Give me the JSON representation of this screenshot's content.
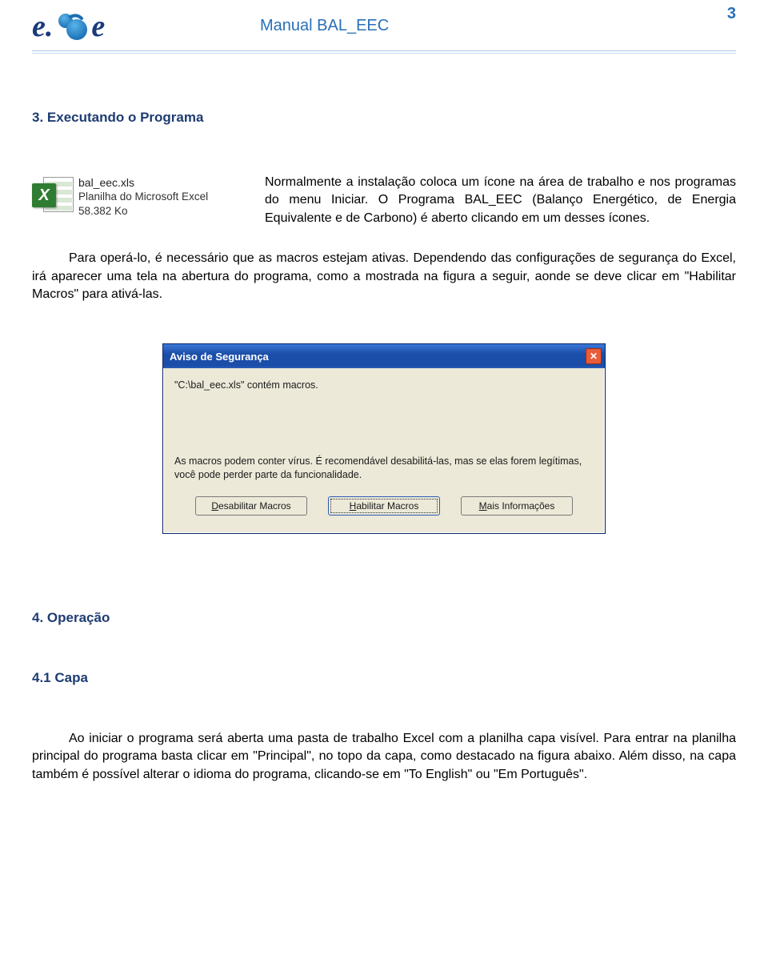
{
  "header": {
    "title": "Manual BAL_EEC",
    "page_number": "3",
    "logo": {
      "left": "e.",
      "right": "e",
      "amp_icon": "ampersand-logo-icon"
    }
  },
  "section3": {
    "heading": "3. Executando o Programa",
    "file_card": {
      "filename": "bal_eec.xls",
      "type": "Planilha do Microsoft Excel",
      "size": "58.382 Ko",
      "icon": "excel-file-icon"
    },
    "intro": "Normalmente a instalação coloca um ícone na área de trabalho e nos programas do menu Iniciar. O Programa BAL_EEC (Balanço Energético, de Energia Equivalente e de Carbono) é aberto clicando em um desses ícones.",
    "para": "Para operá-lo, é necessário que as macros estejam ativas. Dependendo das configurações de segurança do Excel, irá aparecer uma tela na abertura do programa, como a mostrada na figura a seguir, aonde se deve clicar em \"Habilitar Macros\" para ativá-las."
  },
  "dialog": {
    "title": "Aviso de Segurança",
    "close_icon": "close-icon",
    "line1": "\"C:\\bal_eec.xls\" contém macros.",
    "message": "As macros podem conter vírus. É recomendável desabilitá-las, mas se elas forem legítimas, você pode perder parte da funcionalidade.",
    "buttons": {
      "disable": {
        "label": "Desabilitar Macros",
        "underline_index": 0
      },
      "enable": {
        "label": "Habilitar Macros",
        "underline_index": 0
      },
      "more": {
        "label": "Mais Informações",
        "underline_index": 0
      }
    }
  },
  "section4": {
    "heading": "4. Operação",
    "sub_heading": "4.1 Capa",
    "para": "Ao iniciar o programa será aberta uma pasta de trabalho Excel com a planilha capa visível. Para entrar na planilha principal do programa basta clicar em \"Principal\", no topo da capa, como destacado na figura abaixo. Além disso, na capa também é possível alterar o idioma do programa, clicando-se em \"To English\" ou \"Em Português\"."
  }
}
